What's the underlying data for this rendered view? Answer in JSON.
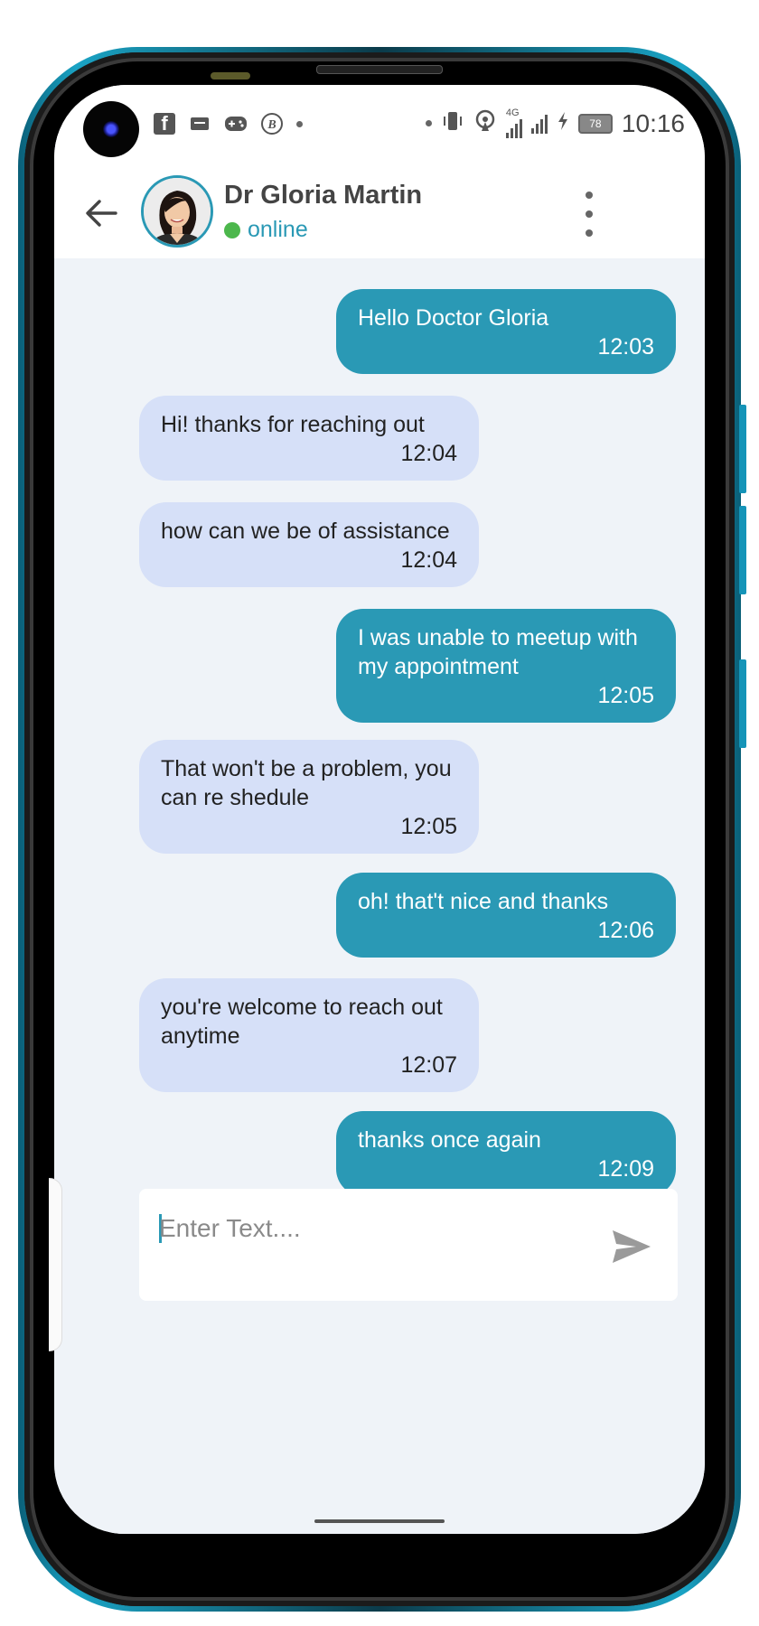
{
  "status_bar": {
    "time": "10:16",
    "battery": "78",
    "network": "4G",
    "icons": [
      "camera-icon",
      "facebook-icon",
      "message-icon",
      "gamepad-icon",
      "b-circle-icon",
      "vibrate-icon",
      "hotspot-icon",
      "signal-icon",
      "charging-icon",
      "battery-icon"
    ]
  },
  "header": {
    "contact_name": "Dr Gloria Martin",
    "status": "online",
    "status_color": "#4cb74c",
    "accent_color": "#2a99b5"
  },
  "messages": [
    {
      "direction": "sent",
      "text": "Hello Doctor Gloria",
      "time": "12:03"
    },
    {
      "direction": "received",
      "text": "Hi! thanks for reaching out",
      "time": "12:04"
    },
    {
      "direction": "received",
      "text": "how can we be of assistance",
      "time": "12:04"
    },
    {
      "direction": "sent",
      "text": "I was unable to meetup with my appointment",
      "time": "12:05"
    },
    {
      "direction": "received",
      "text": "That won't be a problem, you can re shedule",
      "time": "12:05"
    },
    {
      "direction": "sent",
      "text": "oh! that't nice and thanks",
      "time": "12:06"
    },
    {
      "direction": "received",
      "text": "you're welcome to reach out anytime",
      "time": "12:07"
    },
    {
      "direction": "sent",
      "text": "thanks once again",
      "time": "12:09"
    }
  ],
  "composer": {
    "placeholder": "Enter Text....",
    "value": ""
  },
  "colors": {
    "sent_bubble": "#2a99b5",
    "received_bubble": "#d6e0f8",
    "chat_background": "#eff3f8"
  }
}
